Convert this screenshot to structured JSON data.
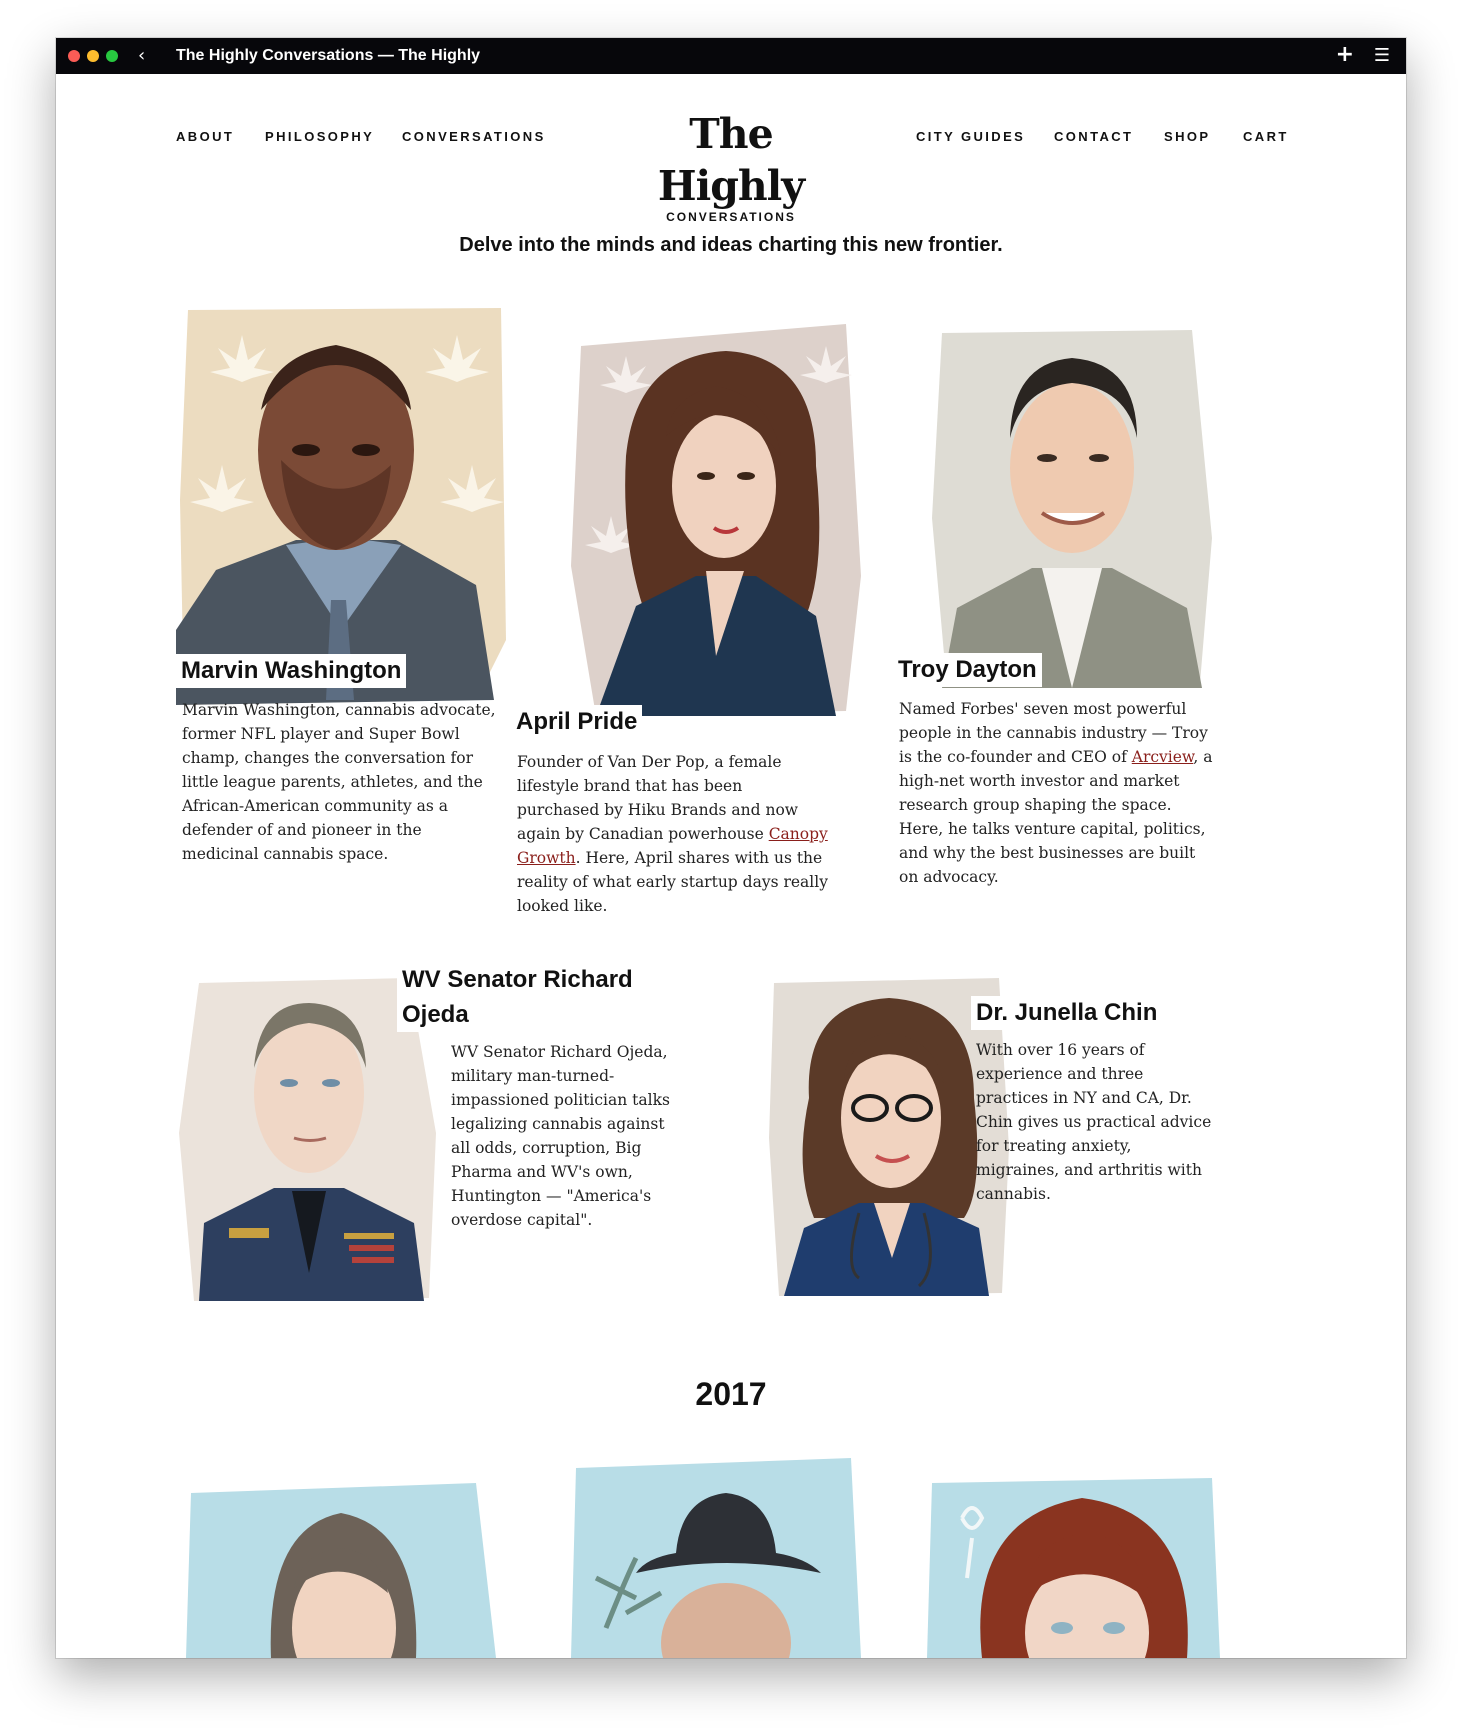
{
  "window": {
    "title": "The Highly Conversations — The Highly"
  },
  "nav": {
    "left": [
      "ABOUT",
      "PHILOSOPHY",
      "CONVERSATIONS"
    ],
    "right": [
      "CITY GUIDES",
      "CONTACT",
      "SHOP",
      "CART"
    ]
  },
  "logo": {
    "title": "The Highly",
    "subtitle": "CONVERSATIONS"
  },
  "tagline": "Delve into the minds and ideas charting this new frontier.",
  "people": [
    {
      "name": "Marvin Washington",
      "bio": "Marvin Washington, cannabis advocate, former NFL player and Super Bowl champ, changes the conversation for little league parents, athletes, and the African-American community as a defender of and pioneer in the medicinal cannabis space."
    },
    {
      "name": "April Pride",
      "bio_before": "Founder of Van Der Pop, a female lifestyle brand that has been purchased by Hiku Brands and now again by Canadian powerhouse ",
      "bio_link": "Canopy Growth",
      "bio_after": ". Here, April shares with us the reality of what early startup days really looked like."
    },
    {
      "name": "Troy Dayton",
      "bio_before": "Named Forbes' seven most powerful people in the cannabis industry — Troy is the co-founder and CEO of ",
      "bio_link": "Arcview",
      "bio_after": ", a high-net worth investor and market research group shaping the space. Here, he talks venture capital, politics, and why the best businesses are built on advocacy."
    },
    {
      "name_line1": "WV Senator Richard",
      "name_line2": "Ojeda",
      "bio": "WV Senator Richard Ojeda, military man-turned-impassioned politician talks legalizing cannabis against all odds, corruption, Big Pharma and WV's own, Huntington — \"America's overdose capital\"."
    },
    {
      "name": "Dr. Junella Chin",
      "bio": "With over 16 years of experience and three practices in NY and CA, Dr. Chin gives us practical advice for treating anxiety, migraines, and arthritis with cannabis."
    }
  ],
  "section_year": "2017",
  "colors": {
    "link": "#8a1f1b",
    "titlebar": "#07070b",
    "text": "#111111"
  },
  "icons": [
    "back-icon",
    "plus-icon",
    "menu-icon"
  ]
}
